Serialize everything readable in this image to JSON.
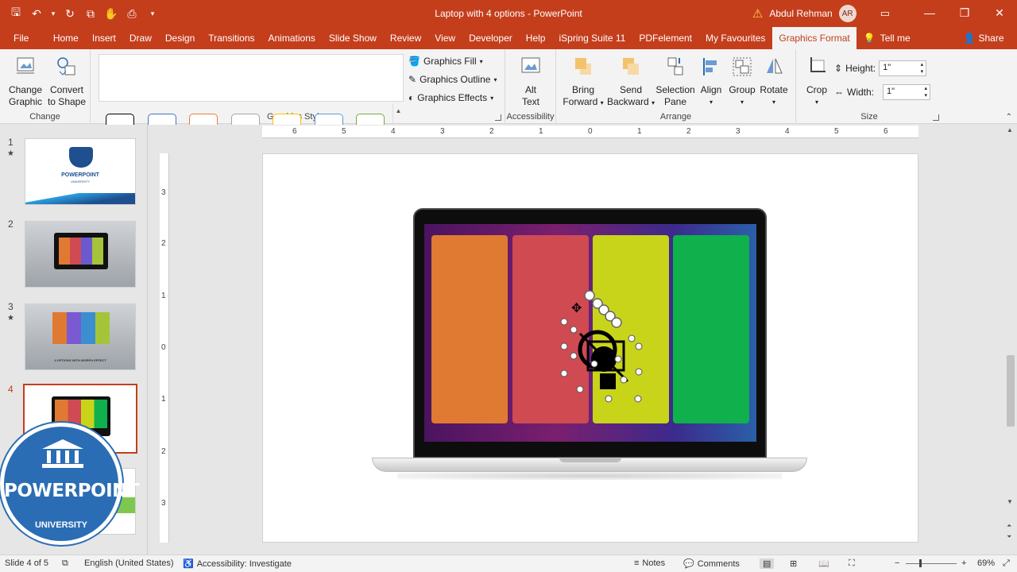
{
  "titlebar": {
    "title": "Laptop with 4 options  -  PowerPoint",
    "user_name": "Abdul Rehman",
    "user_initials": "AR"
  },
  "tabs": [
    "File",
    "Home",
    "Insert",
    "Draw",
    "Design",
    "Transitions",
    "Animations",
    "Slide Show",
    "Review",
    "View",
    "Developer",
    "Help",
    "iSpring Suite 11",
    "PDFelement",
    "My Favourites",
    "Graphics Format",
    "Tell me"
  ],
  "share_label": "Share",
  "ribbon": {
    "change": {
      "change_graphic_l1": "Change",
      "change_graphic_l2": "Graphic",
      "convert_l1": "Convert",
      "convert_l2": "to Shape",
      "label": "Change"
    },
    "styles": {
      "label": "Graphics Styles",
      "fill": "Graphics Fill",
      "outline": "Graphics Outline",
      "effects": "Graphics Effects",
      "swatch_colors": [
        "#000000",
        "#4472c4",
        "#ed7d31",
        "#a5a5a5",
        "#ffc000",
        "#5b9bd5",
        "#70ad47"
      ]
    },
    "accessibility": {
      "alt_l1": "Alt",
      "alt_l2": "Text",
      "label": "Accessibility"
    },
    "arrange": {
      "bring_l1": "Bring",
      "bring_l2": "Forward",
      "send_l1": "Send",
      "send_l2": "Backward",
      "sel_l1": "Selection",
      "sel_l2": "Pane",
      "align": "Align",
      "group": "Group",
      "rotate": "Rotate",
      "label": "Arrange"
    },
    "size": {
      "crop": "Crop",
      "height_label": "Height:",
      "height_value": "1\"",
      "width_label": "Width:",
      "width_value": "1\"",
      "label": "Size"
    }
  },
  "slides": [
    {
      "num": "1",
      "star": "★"
    },
    {
      "num": "2",
      "star": ""
    },
    {
      "num": "3",
      "star": "★"
    },
    {
      "num": "4",
      "star": ""
    }
  ],
  "thumb1": {
    "title": "POWERPOINT",
    "sub": "UNIVERSITY"
  },
  "thumb3": {
    "caption": "4 OPTIONS WITH MORPH EFFECT"
  },
  "logo": {
    "text": "POWERPOINT",
    "sub": "UNIVERSITY"
  },
  "rulers": {
    "h_ticks": [
      "6",
      "5",
      "4",
      "3",
      "2",
      "1",
      "0",
      "1",
      "2",
      "3",
      "4",
      "5",
      "6"
    ],
    "v_ticks": [
      "3",
      "2",
      "1",
      "0",
      "1",
      "2",
      "3"
    ]
  },
  "laptop_panels": [
    "#e07a32",
    "#d04a52",
    "#c8d41a",
    "#10b04c"
  ],
  "status": {
    "slide_info": "Slide 4 of 5",
    "language": "English (United States)",
    "accessibility": "Accessibility: Investigate",
    "notes": "Notes",
    "comments": "Comments",
    "zoom": "69%"
  }
}
